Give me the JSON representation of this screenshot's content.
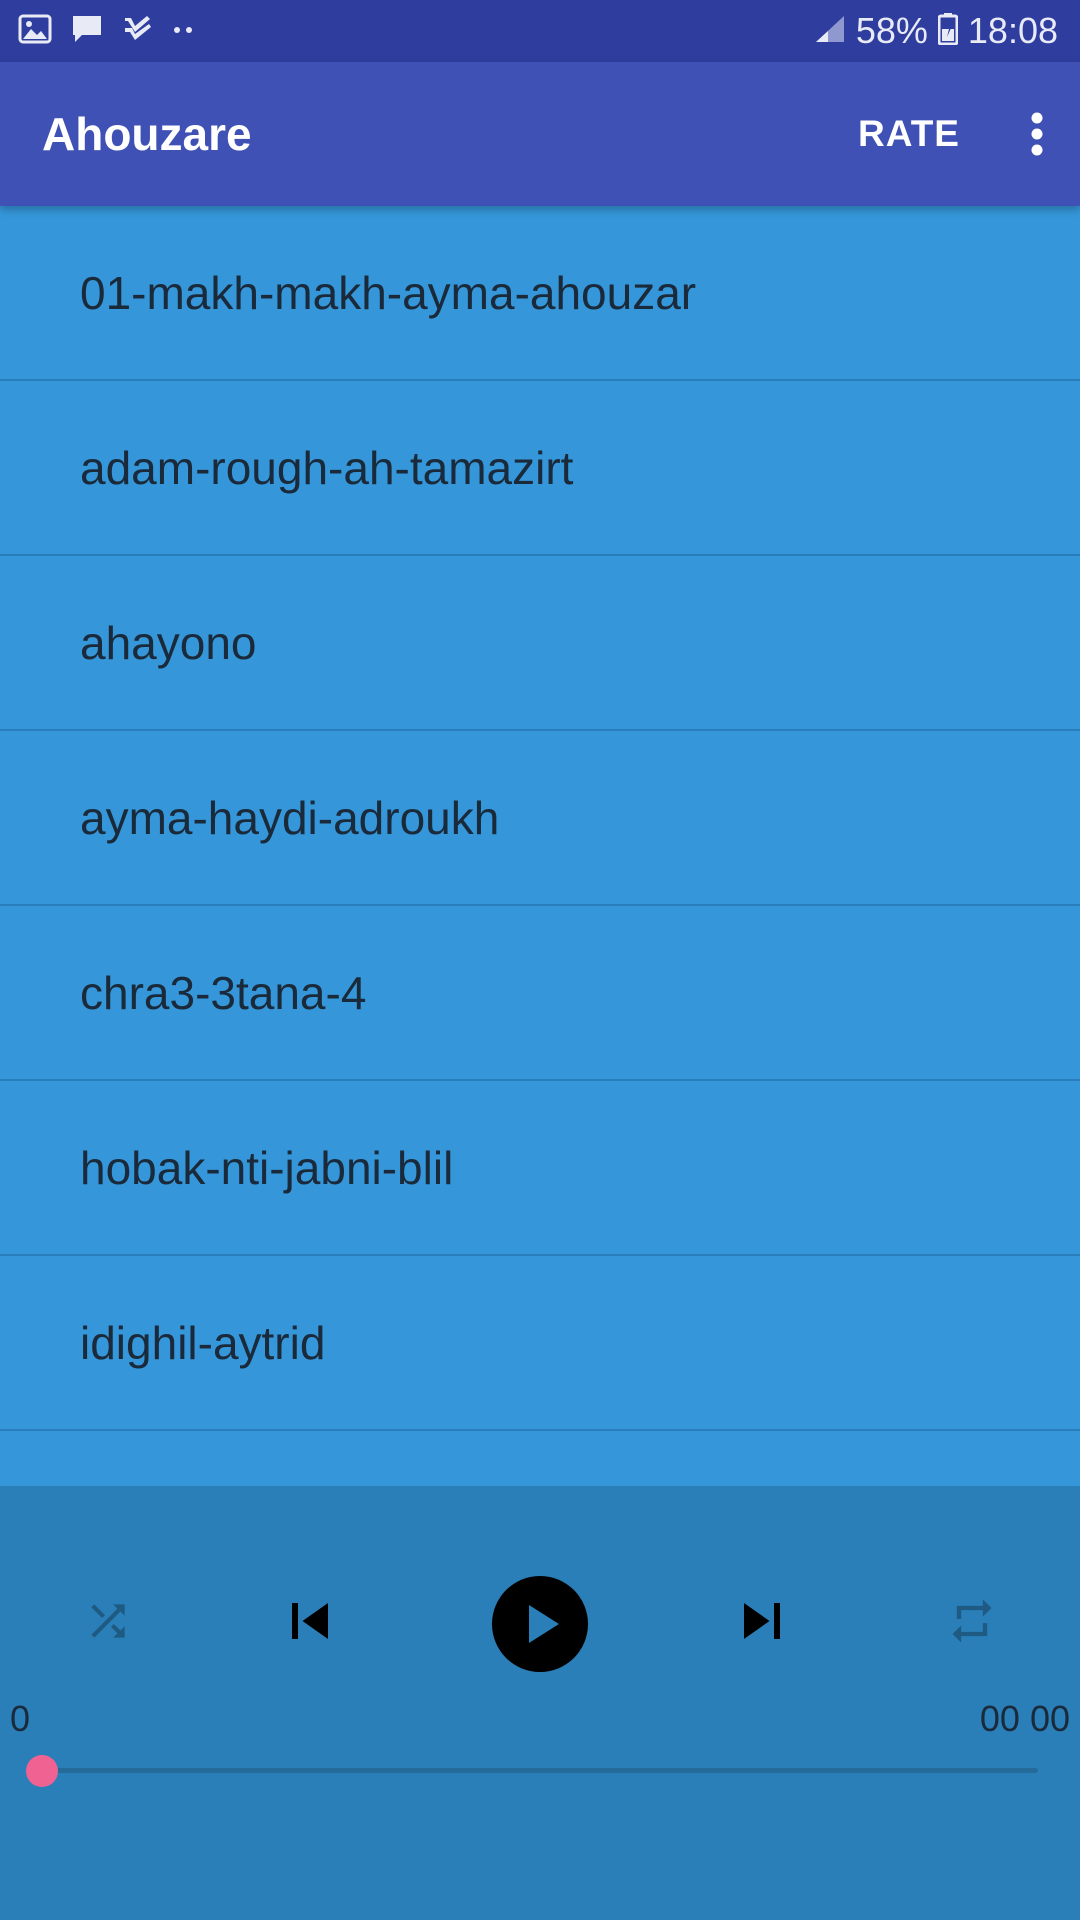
{
  "status_bar": {
    "battery": "58%",
    "time": "18:08"
  },
  "app_bar": {
    "title": "Ahouzare",
    "rate_label": "RATE"
  },
  "tracks": [
    {
      "title": "01-makh-makh-ayma-ahouzar"
    },
    {
      "title": "adam-rough-ah-tamazirt"
    },
    {
      "title": "ahayono"
    },
    {
      "title": "ayma-haydi-adroukh"
    },
    {
      "title": "chra3-3tana-4"
    },
    {
      "title": "hobak-nti-jabni-blil"
    },
    {
      "title": "idighil-aytrid"
    },
    {
      "title": ""
    }
  ],
  "player": {
    "time_elapsed": "0",
    "time_total": "00 00",
    "progress": 0
  },
  "colors": {
    "status_bar": "#2f3e9e",
    "app_bar": "#3f51b5",
    "list_bg": "#3597da",
    "player_bg": "#2a7fb9",
    "seek_thumb": "#f06292"
  }
}
